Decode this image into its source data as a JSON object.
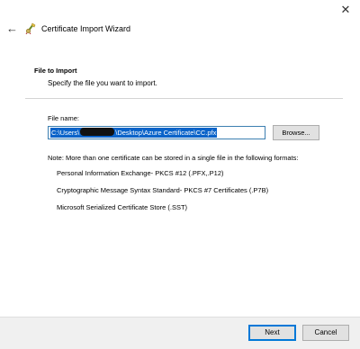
{
  "header": {
    "close_glyph": "✕",
    "back_glyph": "←",
    "title": "Certificate Import Wizard"
  },
  "section": {
    "title": "File to Import",
    "subtitle": "Specify the file you want to import."
  },
  "file": {
    "label": "File name:",
    "value_prefix": "C:\\Users\\",
    "value_suffix": "\\Desktop\\Azure Certificate\\CC.pfx",
    "browse_label": "Browse..."
  },
  "note": {
    "text": "Note:  More than one certificate can be stored in a single file in the following formats:",
    "formats": [
      "Personal Information Exchange- PKCS #12 (.PFX,.P12)",
      "Cryptographic Message Syntax Standard- PKCS #7 Certificates (.P7B)",
      "Microsoft Serialized Certificate Store (.SST)"
    ]
  },
  "footer": {
    "next_label": "Next",
    "cancel_label": "Cancel"
  },
  "colors": {
    "selection": "#0a63c9",
    "focus_border": "#0078d7",
    "button_face": "#e1e1e1",
    "footer_bg": "#f0f0f0"
  },
  "icons": {
    "wizard": "certificate-wizard-icon",
    "back": "back-arrow-icon",
    "close": "close-icon"
  }
}
